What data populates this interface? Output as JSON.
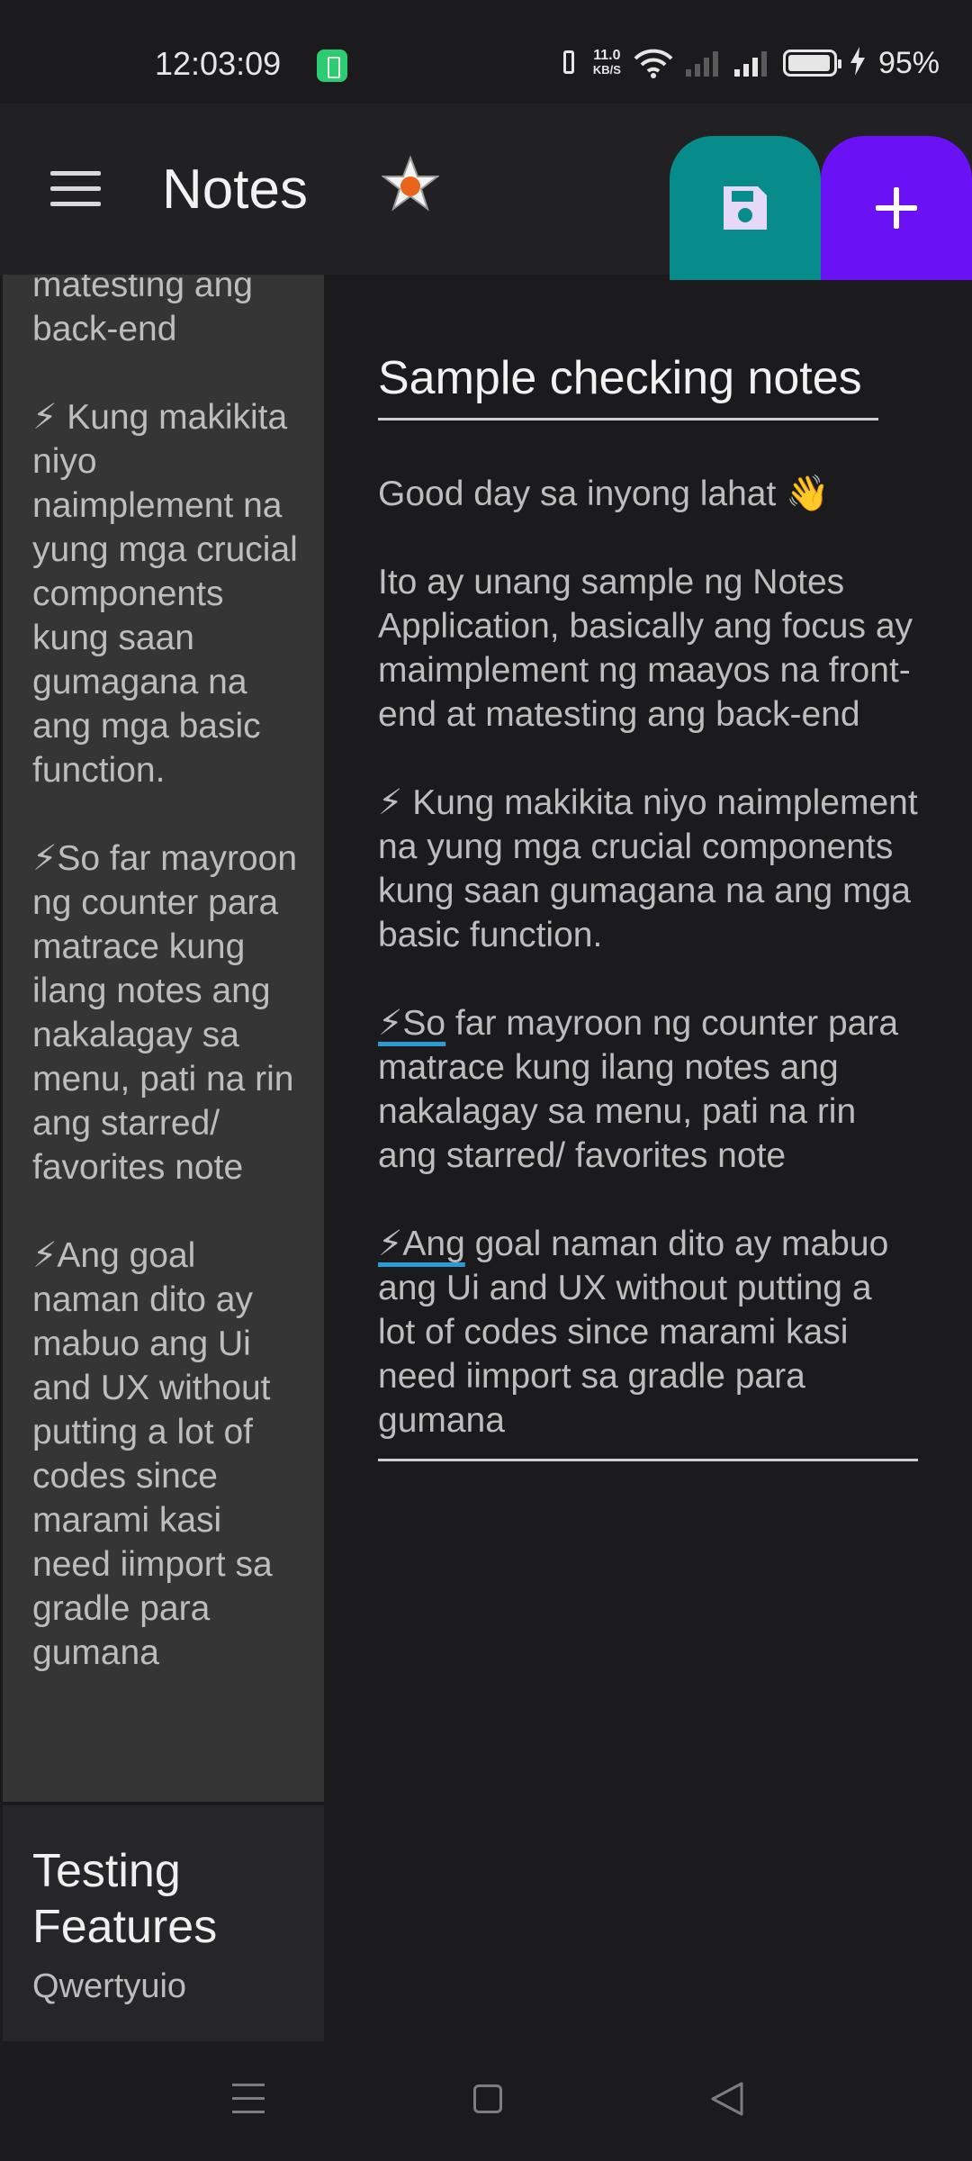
{
  "status_bar": {
    "time": "12:03:09",
    "net_speed_value": "11.0",
    "net_speed_unit": "KB/S",
    "battery_percent": "95%",
    "icons": [
      "battery-saver-icon",
      "vibrate-icon",
      "wifi-icon",
      "signal-icon",
      "battery-icon",
      "charging-icon"
    ]
  },
  "app_bar": {
    "title": "Notes",
    "icons": [
      "menu-icon",
      "star-icon",
      "save-icon",
      "plus-icon"
    ],
    "colors": {
      "save_fab": "#078b8b",
      "add_fab": "#6a11f5",
      "star_center": "#e8651a"
    }
  },
  "sidebar": {
    "notes": [
      {
        "text": "matesting ang back-end\n\n⚡ Kung makikita niyo naimplement na yung mga crucial components kung saan gumagana na ang mga basic function.\n\n⚡So far mayroon ng counter para matrace kung ilang notes ang nakalagay sa menu, pati na rin ang starred/ favorites note\n\n⚡Ang goal naman dito ay mabuo ang Ui and UX without putting a lot of codes since marami kasi need iimport sa gradle para gumana"
      },
      {
        "title": "Testing Features",
        "subtitle": "Qwertyuio"
      }
    ]
  },
  "editor": {
    "title": "Sample checking notes",
    "body": {
      "p1": "Good day sa inyong lahat 👋",
      "p2": "Ito ay unang sample ng Notes Application, basically ang focus ay maimplement ng maayos na front-end at matesting ang back-end",
      "p3": "⚡ Kung makikita niyo naimplement na yung mga crucial components kung saan gumagana na ang mga basic function.",
      "p4_underlined": "⚡So",
      "p4_rest": " far mayroon ng counter para matrace kung ilang notes ang nakalagay sa menu, pati na rin ang starred/ favorites note",
      "p5_underlined": "⚡Ang",
      "p5_rest": " goal naman dito ay mabuo ang Ui and UX without putting a lot of codes since marami kasi need iimport sa gradle para gumana"
    }
  },
  "nav_bar": {
    "icons": [
      "nav-menu-icon",
      "nav-home-icon",
      "nav-back-icon"
    ]
  }
}
